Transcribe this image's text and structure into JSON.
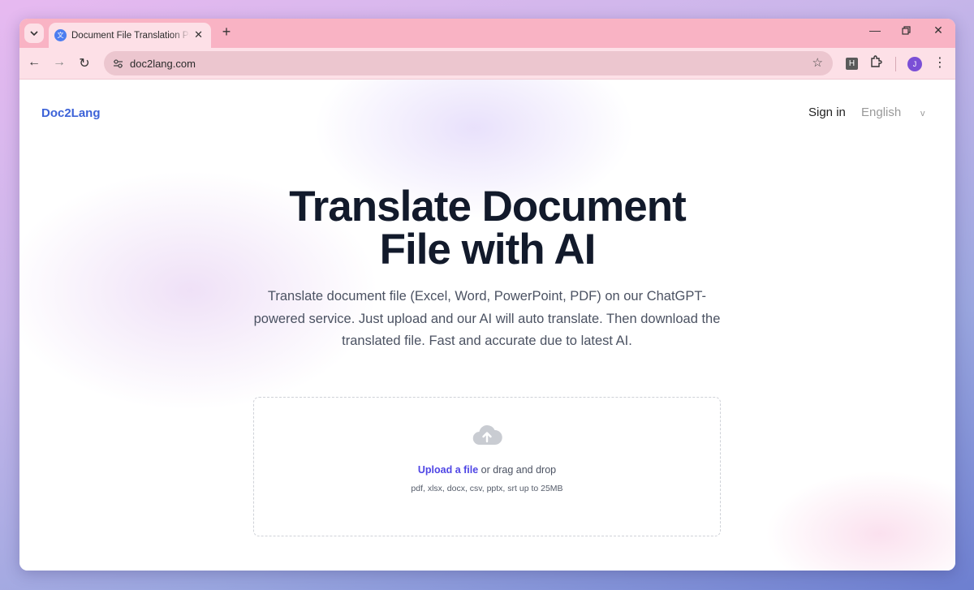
{
  "browser": {
    "tab_title": "Document File Translation Powered by AI",
    "url": "doc2lang.com",
    "extension_badge": "H",
    "profile_initial": "J",
    "icons": [
      "tab-search-icon",
      "translate-favicon",
      "close-icon",
      "plus-icon",
      "minimize-icon",
      "restore-icon",
      "window-close-icon",
      "back-icon",
      "forward-icon",
      "reload-icon",
      "site-info-icon",
      "star-icon",
      "extension-icon",
      "puzzle-icon",
      "kebab-menu-icon"
    ]
  },
  "page": {
    "logo": "Doc2Lang",
    "sign_in": "Sign in",
    "language": "English",
    "language_chevron": "v",
    "hero_title_line1": "Translate Document",
    "hero_title_line2": "File with AI",
    "hero_subtitle": "Translate document file (Excel, Word, PowerPoint, PDF) on our ChatGPT-powered service. Just upload and our AI will auto translate. Then download the translated file. Fast and accurate due to latest AI.",
    "upload": {
      "link_label": "Upload a file",
      "rest_label": " or drag and drop",
      "formats": "pdf, xlsx, docx, csv, pptx, srt up to 25MB"
    }
  },
  "colors": {
    "accent": "#3d63d8",
    "upload_link": "#4f46e5",
    "tabstrip": "#f9b3c4",
    "toolbar": "#fde0e7"
  }
}
